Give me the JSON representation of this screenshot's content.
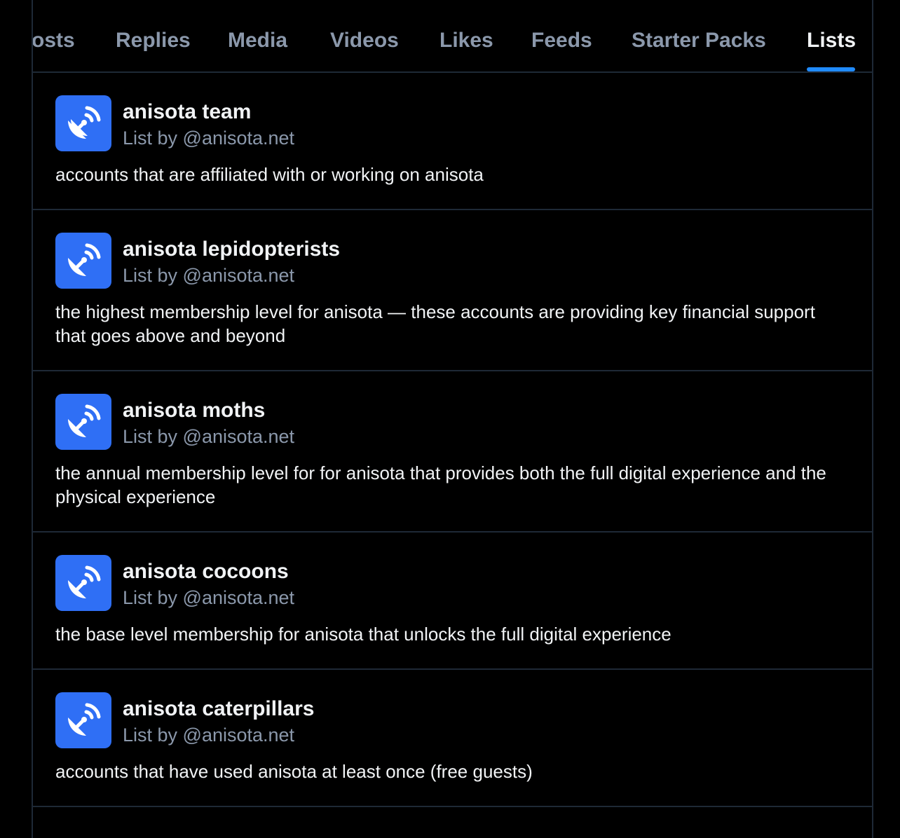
{
  "tabs": [
    {
      "label": "osts",
      "active": false
    },
    {
      "label": "Replies",
      "active": false
    },
    {
      "label": "Media",
      "active": false
    },
    {
      "label": "Videos",
      "active": false
    },
    {
      "label": "Likes",
      "active": false
    },
    {
      "label": "Feeds",
      "active": false
    },
    {
      "label": "Starter Packs",
      "active": false
    },
    {
      "label": "Lists",
      "active": true
    }
  ],
  "lists": [
    {
      "title": "anisota team",
      "byline": "List by @anisota.net",
      "description": "accounts that are affiliated with or working on anisota",
      "icon": "satellite-dish-icon"
    },
    {
      "title": "anisota lepidopterists",
      "byline": "List by @anisota.net",
      "description": "the highest membership level for anisota — these accounts are providing key financial support that goes above and beyond",
      "icon": "satellite-dish-icon"
    },
    {
      "title": "anisota moths",
      "byline": "List by @anisota.net",
      "description": "the annual membership level for for anisota that provides both the full digital experience and the physical experience",
      "icon": "satellite-dish-icon"
    },
    {
      "title": "anisota cocoons",
      "byline": "List by @anisota.net",
      "description": "the base level membership for anisota that unlocks the full digital experience",
      "icon": "satellite-dish-icon"
    },
    {
      "title": "anisota caterpillars",
      "byline": "List by @anisota.net",
      "description": "accounts that have used anisota at least once (free guests)",
      "icon": "satellite-dish-icon"
    }
  ],
  "colors": {
    "background": "#000000",
    "border": "#1e2936",
    "text_primary": "#f1f3f5",
    "text_secondary": "#8b98ab",
    "accent": "#208bfe",
    "avatar": "#2f6ff5"
  }
}
